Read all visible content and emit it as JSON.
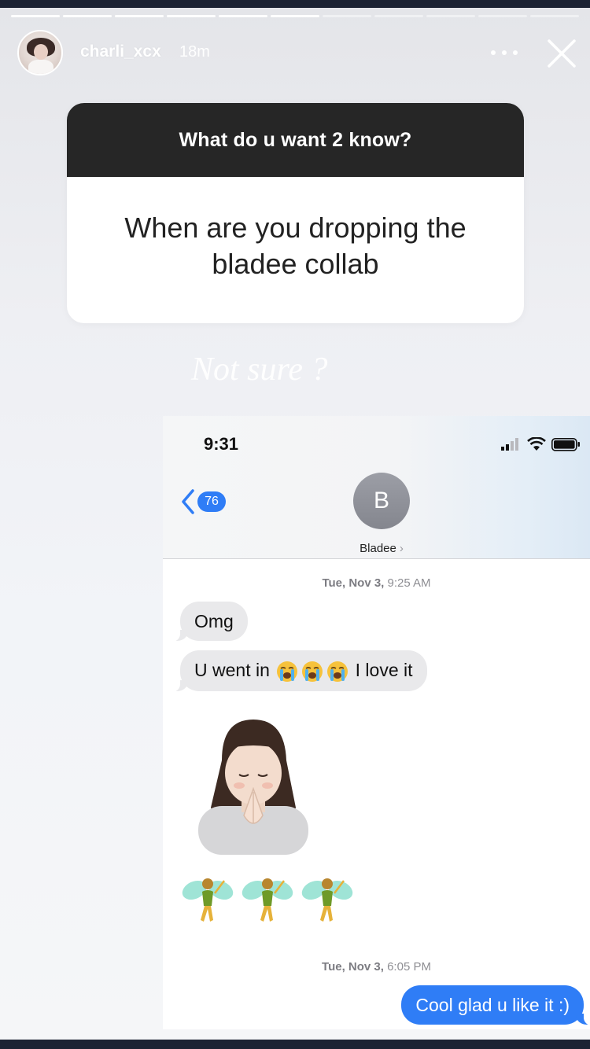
{
  "story": {
    "segments": 11,
    "progress_fractions": [
      1,
      1,
      1,
      1,
      1,
      1,
      0,
      0,
      0,
      0,
      0
    ],
    "header": {
      "username": "charli_xcx",
      "time_ago": "18m",
      "avatar_icon": "profile-avatar",
      "more_icon": "ellipsis-icon",
      "close_icon": "close-icon"
    },
    "question_sticker": {
      "prompt": "What do u want 2 know?",
      "answer": "When are you dropping the bladee collab"
    },
    "caption": "Not sure ?"
  },
  "screenshot": {
    "status_bar": {
      "time": "9:31",
      "icons": [
        "signal-icon",
        "wifi-icon",
        "battery-icon"
      ]
    },
    "nav": {
      "back_count": "76",
      "contact_initial": "B",
      "contact_name": "Bladee",
      "chevron": "›"
    },
    "thread": [
      {
        "type": "timestamp",
        "day": "Tue, Nov 3,",
        "time": "9:25 AM"
      },
      {
        "type": "incoming",
        "text": "Omg"
      },
      {
        "type": "incoming",
        "before": "U went in",
        "emoji": [
          "loudly-crying-face",
          "loudly-crying-face",
          "loudly-crying-face"
        ],
        "after": "I love it"
      },
      {
        "type": "sticker",
        "name": "memoji-praying"
      },
      {
        "type": "emoji-row",
        "emoji": [
          "fairy",
          "fairy",
          "fairy"
        ]
      },
      {
        "type": "timestamp",
        "day": "Tue, Nov 3,",
        "time": "6:05 PM"
      },
      {
        "type": "outgoing",
        "text": "Cool glad u like it :)"
      }
    ]
  },
  "colors": {
    "story_bg": "#eeeff3",
    "question_header": "#262626",
    "imessage_blue": "#2f7df6",
    "incoming_bubble": "#e9e9eb",
    "frame": "#1c2233"
  }
}
